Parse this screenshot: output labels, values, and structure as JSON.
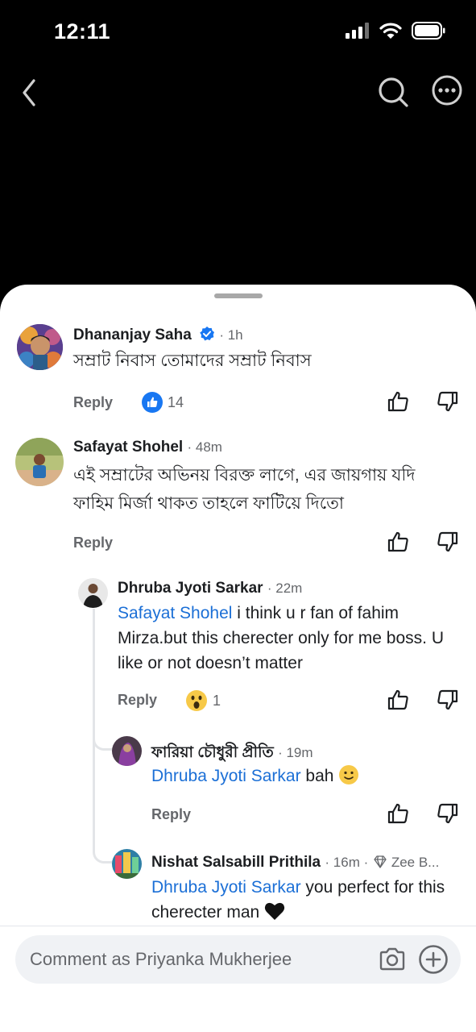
{
  "status_bar": {
    "time": "12:11"
  },
  "comments": [
    {
      "author": "Dhananjay Saha",
      "verified": true,
      "time": "· 1h",
      "text": "সম্রাট নিবাস তোমাদের সম্রাট নিবাস",
      "reply_label": "Reply",
      "reaction_count": "14"
    },
    {
      "author": "Safayat Shohel",
      "time": "· 48m",
      "text": "এই সম্রাটের অভিনয় বিরক্ত লাগে, এর জায়গায় যদি ফাহিম মির্জা থাকত তাহলে ফাটিয়ে দিতো",
      "reply_label": "Reply"
    }
  ],
  "replies": [
    {
      "author": "Dhruba Jyoti Sarkar",
      "time": "· 22m",
      "mention": "Safayat Shohel",
      "text": " i think u r fan of fahim Mirza.but this cherecter only for me boss. U like or not doesn’t matter",
      "reply_label": "Reply",
      "reaction_count": "1"
    },
    {
      "author": "ফারিয়া চৌধুরী প্রীতি",
      "time": "· 19m",
      "mention": "Dhruba Jyoti Sarkar",
      "text": " bah",
      "reply_label": "Reply"
    },
    {
      "author": "Nishat Salsabill Prithila",
      "time": "· 16m ·",
      "badge": "Zee B...",
      "mention": "Dhruba Jyoti Sarkar",
      "text": " you perfect for this cherecter man"
    }
  ],
  "composer": {
    "placeholder": "Comment as Priyanka Mukherjee"
  },
  "colors": {
    "mention": "#1b6fd6",
    "like_blue": "#1877f2",
    "text": "#1c1e21",
    "meta": "#65676b"
  }
}
